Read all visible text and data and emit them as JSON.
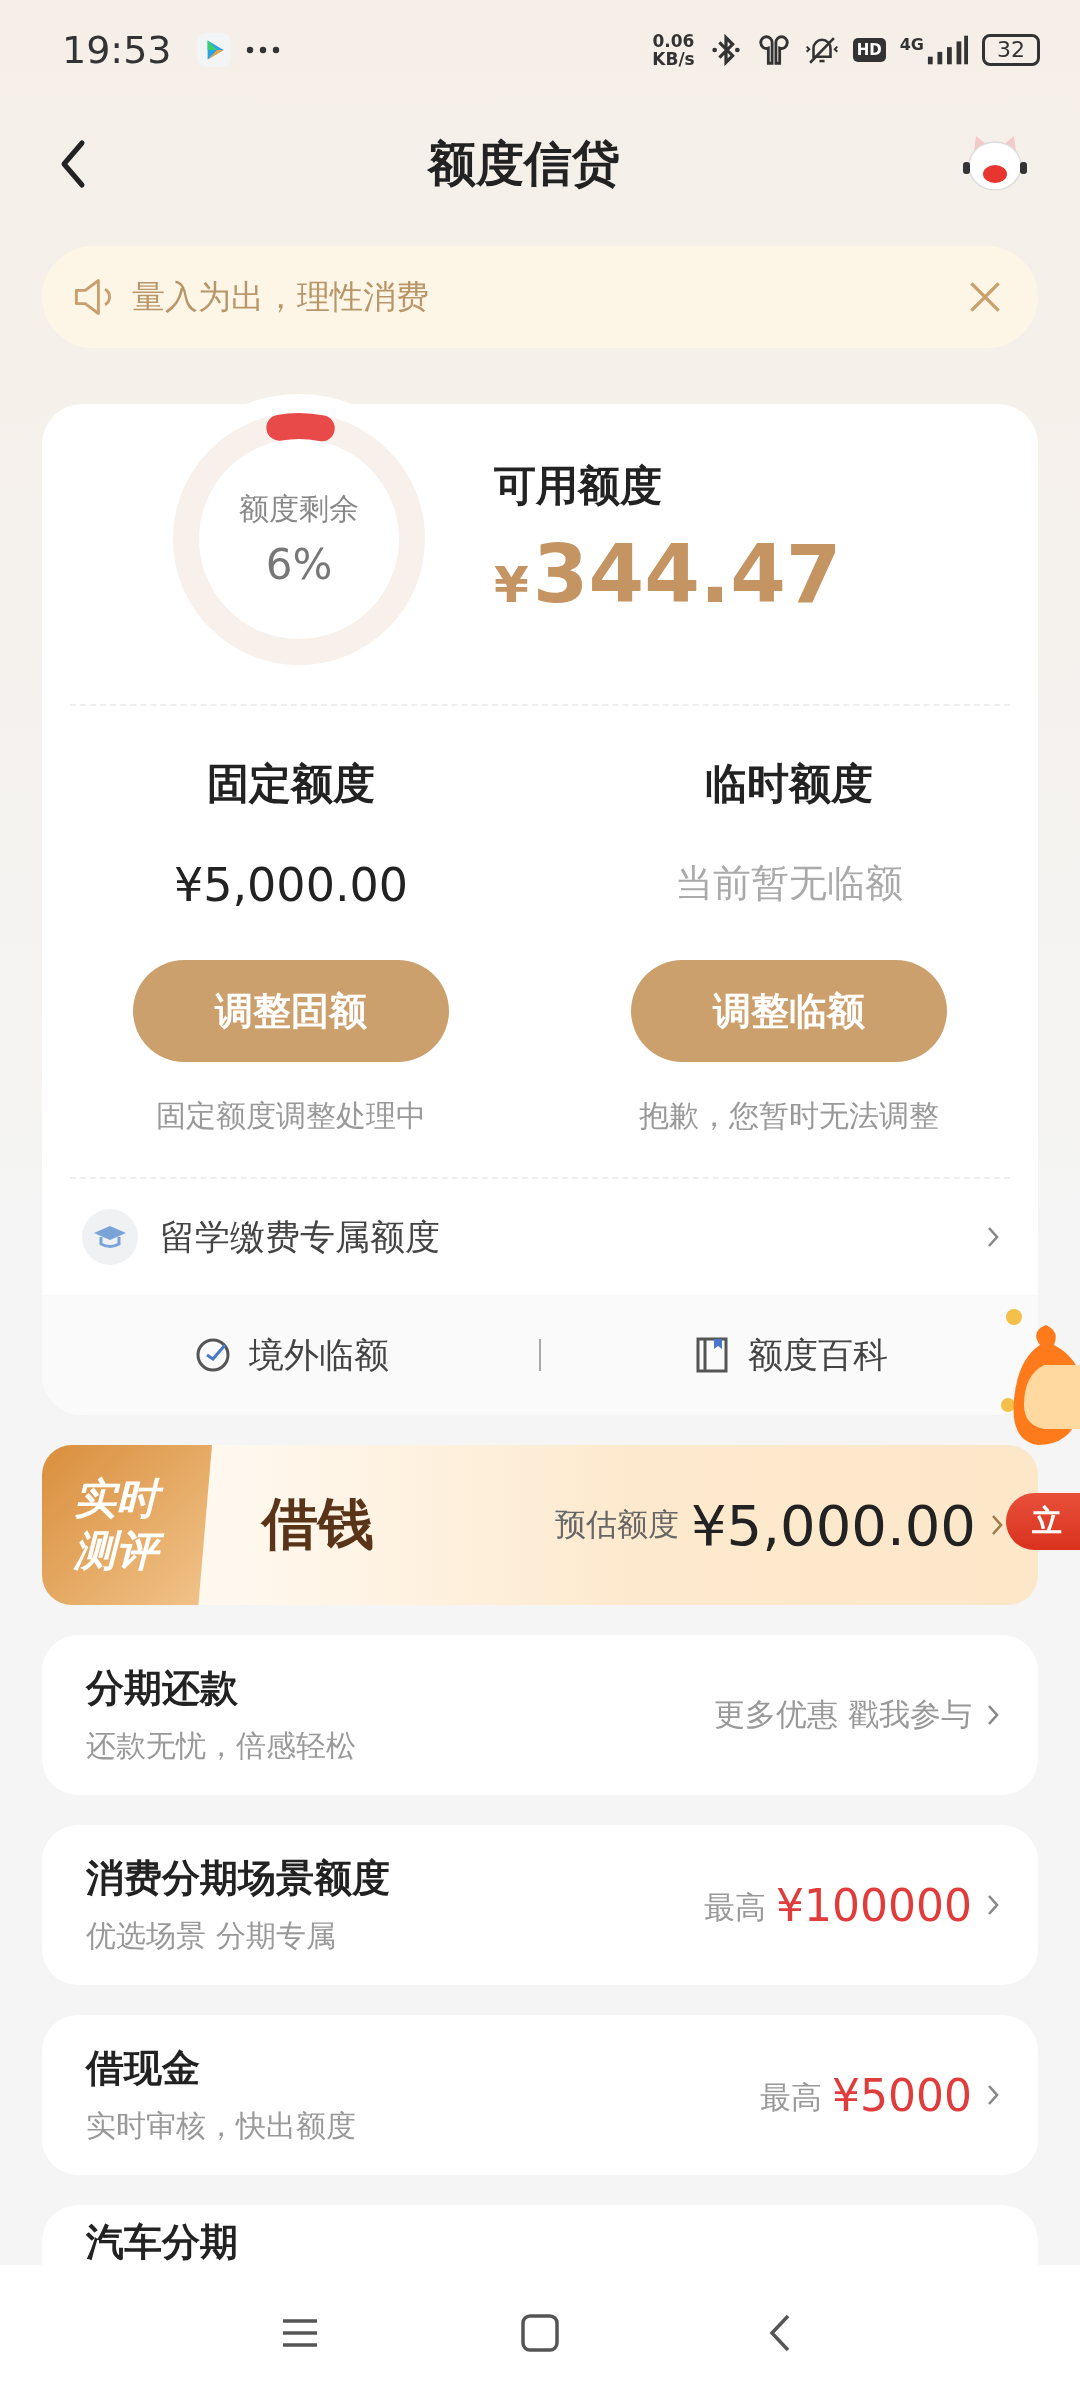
{
  "status_bar": {
    "time": "19:53",
    "net_speed": [
      "0.06",
      "KB/s"
    ],
    "hd": "HD",
    "network": "4G",
    "battery": "32"
  },
  "header": {
    "title": "额度信贷"
  },
  "notice": {
    "text": "量入为出，理性消费"
  },
  "quota": {
    "ring_label": "额度剩余",
    "ring_value": "6%",
    "available_label": "可用额度",
    "currency": "¥",
    "amount": "344.47"
  },
  "columns": [
    {
      "title": "固定额度",
      "kind": "amount",
      "value": "¥5,000.00",
      "button": "调整固额",
      "note": "固定额度调整处理中"
    },
    {
      "title": "临时额度",
      "kind": "empty",
      "value": "当前暂无临额",
      "button": "调整临额",
      "note": "抱歉，您暂时无法调整"
    }
  ],
  "study_row": {
    "label": "留学缴费专属额度"
  },
  "links": [
    {
      "kind": "globe",
      "label": "境外临额"
    },
    {
      "kind": "book",
      "label": "额度百科"
    }
  ],
  "banner": {
    "tag": [
      "实时",
      "测评"
    ],
    "title": "借钱",
    "hint": "预估额度",
    "amount": "¥5,000.00"
  },
  "float_badge": {
    "label": "立"
  },
  "products": [
    {
      "kind": "promo",
      "title": "分期还款",
      "subtitle": "还款无忧，倍感轻松",
      "extra": "更多优惠 戳我参与"
    },
    {
      "kind": "max",
      "title": "消费分期场景额度",
      "subtitle": "优选场景 分期专属",
      "prefix": "最高",
      "amount": "¥100000"
    },
    {
      "kind": "max",
      "title": "借现金",
      "subtitle": "实时审核，快出额度",
      "prefix": "最高",
      "amount": "¥5000"
    },
    {
      "kind": "cut",
      "title": "汽车分期"
    }
  ]
}
